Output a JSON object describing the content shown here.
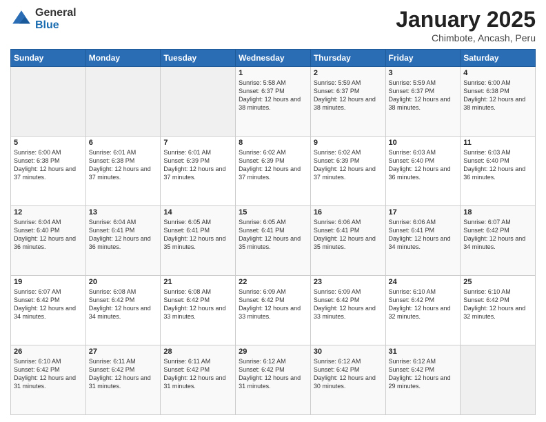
{
  "logo": {
    "general": "General",
    "blue": "Blue"
  },
  "title": "January 2025",
  "subtitle": "Chimbote, Ancash, Peru",
  "days_of_week": [
    "Sunday",
    "Monday",
    "Tuesday",
    "Wednesday",
    "Thursday",
    "Friday",
    "Saturday"
  ],
  "weeks": [
    [
      {
        "day": "",
        "info": ""
      },
      {
        "day": "",
        "info": ""
      },
      {
        "day": "",
        "info": ""
      },
      {
        "day": "1",
        "info": "Sunrise: 5:58 AM\nSunset: 6:37 PM\nDaylight: 12 hours and 38 minutes."
      },
      {
        "day": "2",
        "info": "Sunrise: 5:59 AM\nSunset: 6:37 PM\nDaylight: 12 hours and 38 minutes."
      },
      {
        "day": "3",
        "info": "Sunrise: 5:59 AM\nSunset: 6:37 PM\nDaylight: 12 hours and 38 minutes."
      },
      {
        "day": "4",
        "info": "Sunrise: 6:00 AM\nSunset: 6:38 PM\nDaylight: 12 hours and 38 minutes."
      }
    ],
    [
      {
        "day": "5",
        "info": "Sunrise: 6:00 AM\nSunset: 6:38 PM\nDaylight: 12 hours and 37 minutes."
      },
      {
        "day": "6",
        "info": "Sunrise: 6:01 AM\nSunset: 6:38 PM\nDaylight: 12 hours and 37 minutes."
      },
      {
        "day": "7",
        "info": "Sunrise: 6:01 AM\nSunset: 6:39 PM\nDaylight: 12 hours and 37 minutes."
      },
      {
        "day": "8",
        "info": "Sunrise: 6:02 AM\nSunset: 6:39 PM\nDaylight: 12 hours and 37 minutes."
      },
      {
        "day": "9",
        "info": "Sunrise: 6:02 AM\nSunset: 6:39 PM\nDaylight: 12 hours and 37 minutes."
      },
      {
        "day": "10",
        "info": "Sunrise: 6:03 AM\nSunset: 6:40 PM\nDaylight: 12 hours and 36 minutes."
      },
      {
        "day": "11",
        "info": "Sunrise: 6:03 AM\nSunset: 6:40 PM\nDaylight: 12 hours and 36 minutes."
      }
    ],
    [
      {
        "day": "12",
        "info": "Sunrise: 6:04 AM\nSunset: 6:40 PM\nDaylight: 12 hours and 36 minutes."
      },
      {
        "day": "13",
        "info": "Sunrise: 6:04 AM\nSunset: 6:41 PM\nDaylight: 12 hours and 36 minutes."
      },
      {
        "day": "14",
        "info": "Sunrise: 6:05 AM\nSunset: 6:41 PM\nDaylight: 12 hours and 35 minutes."
      },
      {
        "day": "15",
        "info": "Sunrise: 6:05 AM\nSunset: 6:41 PM\nDaylight: 12 hours and 35 minutes."
      },
      {
        "day": "16",
        "info": "Sunrise: 6:06 AM\nSunset: 6:41 PM\nDaylight: 12 hours and 35 minutes."
      },
      {
        "day": "17",
        "info": "Sunrise: 6:06 AM\nSunset: 6:41 PM\nDaylight: 12 hours and 34 minutes."
      },
      {
        "day": "18",
        "info": "Sunrise: 6:07 AM\nSunset: 6:42 PM\nDaylight: 12 hours and 34 minutes."
      }
    ],
    [
      {
        "day": "19",
        "info": "Sunrise: 6:07 AM\nSunset: 6:42 PM\nDaylight: 12 hours and 34 minutes."
      },
      {
        "day": "20",
        "info": "Sunrise: 6:08 AM\nSunset: 6:42 PM\nDaylight: 12 hours and 34 minutes."
      },
      {
        "day": "21",
        "info": "Sunrise: 6:08 AM\nSunset: 6:42 PM\nDaylight: 12 hours and 33 minutes."
      },
      {
        "day": "22",
        "info": "Sunrise: 6:09 AM\nSunset: 6:42 PM\nDaylight: 12 hours and 33 minutes."
      },
      {
        "day": "23",
        "info": "Sunrise: 6:09 AM\nSunset: 6:42 PM\nDaylight: 12 hours and 33 minutes."
      },
      {
        "day": "24",
        "info": "Sunrise: 6:10 AM\nSunset: 6:42 PM\nDaylight: 12 hours and 32 minutes."
      },
      {
        "day": "25",
        "info": "Sunrise: 6:10 AM\nSunset: 6:42 PM\nDaylight: 12 hours and 32 minutes."
      }
    ],
    [
      {
        "day": "26",
        "info": "Sunrise: 6:10 AM\nSunset: 6:42 PM\nDaylight: 12 hours and 31 minutes."
      },
      {
        "day": "27",
        "info": "Sunrise: 6:11 AM\nSunset: 6:42 PM\nDaylight: 12 hours and 31 minutes."
      },
      {
        "day": "28",
        "info": "Sunrise: 6:11 AM\nSunset: 6:42 PM\nDaylight: 12 hours and 31 minutes."
      },
      {
        "day": "29",
        "info": "Sunrise: 6:12 AM\nSunset: 6:42 PM\nDaylight: 12 hours and 31 minutes."
      },
      {
        "day": "30",
        "info": "Sunrise: 6:12 AM\nSunset: 6:42 PM\nDaylight: 12 hours and 30 minutes."
      },
      {
        "day": "31",
        "info": "Sunrise: 6:12 AM\nSunset: 6:42 PM\nDaylight: 12 hours and 29 minutes."
      },
      {
        "day": "",
        "info": ""
      }
    ]
  ]
}
